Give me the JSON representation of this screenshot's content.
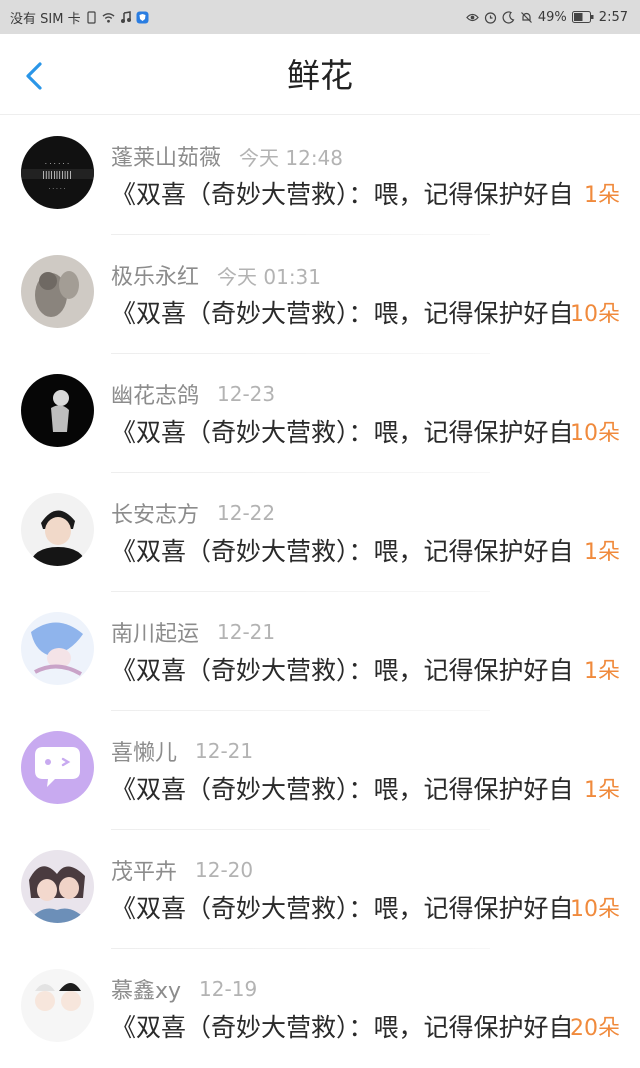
{
  "status_bar": {
    "carrier": "没有 SIM 卡",
    "battery": "49%",
    "time": "2:57"
  },
  "header": {
    "title": "鲜花",
    "back_icon": "chevron-left-icon"
  },
  "colors": {
    "accent_blue": "#2a96e8",
    "count_orange": "#f08a3c"
  },
  "items": [
    {
      "name": "蓬莱山茹薇",
      "time": "今天 12:48",
      "message": "《双喜（奇妙大营救）：喂，记得保护好自己。》",
      "count": "1朵",
      "avatar": "avatar-tnt-poster"
    },
    {
      "name": "极乐永红",
      "time": "今天 01:31",
      "message": "《双喜（奇妙大营救）：喂，记得保护好自己。》",
      "count": "10朵",
      "avatar": "avatar-kitten"
    },
    {
      "name": "幽花志鸽",
      "time": "12-23",
      "message": "《双喜（奇妙大营救）：喂，记得保护好自己。》",
      "count": "10朵",
      "avatar": "avatar-dark-portrait"
    },
    {
      "name": "长安志方",
      "time": "12-22",
      "message": "《双喜（奇妙大营救）：喂，记得保护好自己。》",
      "count": "1朵",
      "avatar": "avatar-boy-portrait"
    },
    {
      "name": "南川起运",
      "time": "12-21",
      "message": "《双喜（奇妙大营救）：喂，记得保护好自己。》",
      "count": "1朵",
      "avatar": "avatar-anime-blue"
    },
    {
      "name": "喜懒儿",
      "time": "12-21",
      "message": "《双喜（奇妙大营救）：喂，记得保护好自己。》",
      "count": "1朵",
      "avatar": "avatar-chat-bubble"
    },
    {
      "name": "茂平卉",
      "time": "12-20",
      "message": "《双喜（奇妙大营救）：喂，记得保护好自己。》",
      "count": "10朵",
      "avatar": "avatar-anime-couple"
    },
    {
      "name": "慕鑫xy",
      "time": "12-19",
      "message": "《双喜（奇妙大营救）：喂，记得保护好自己。》",
      "count": "20朵",
      "avatar": "avatar-chibi-pair"
    }
  ]
}
